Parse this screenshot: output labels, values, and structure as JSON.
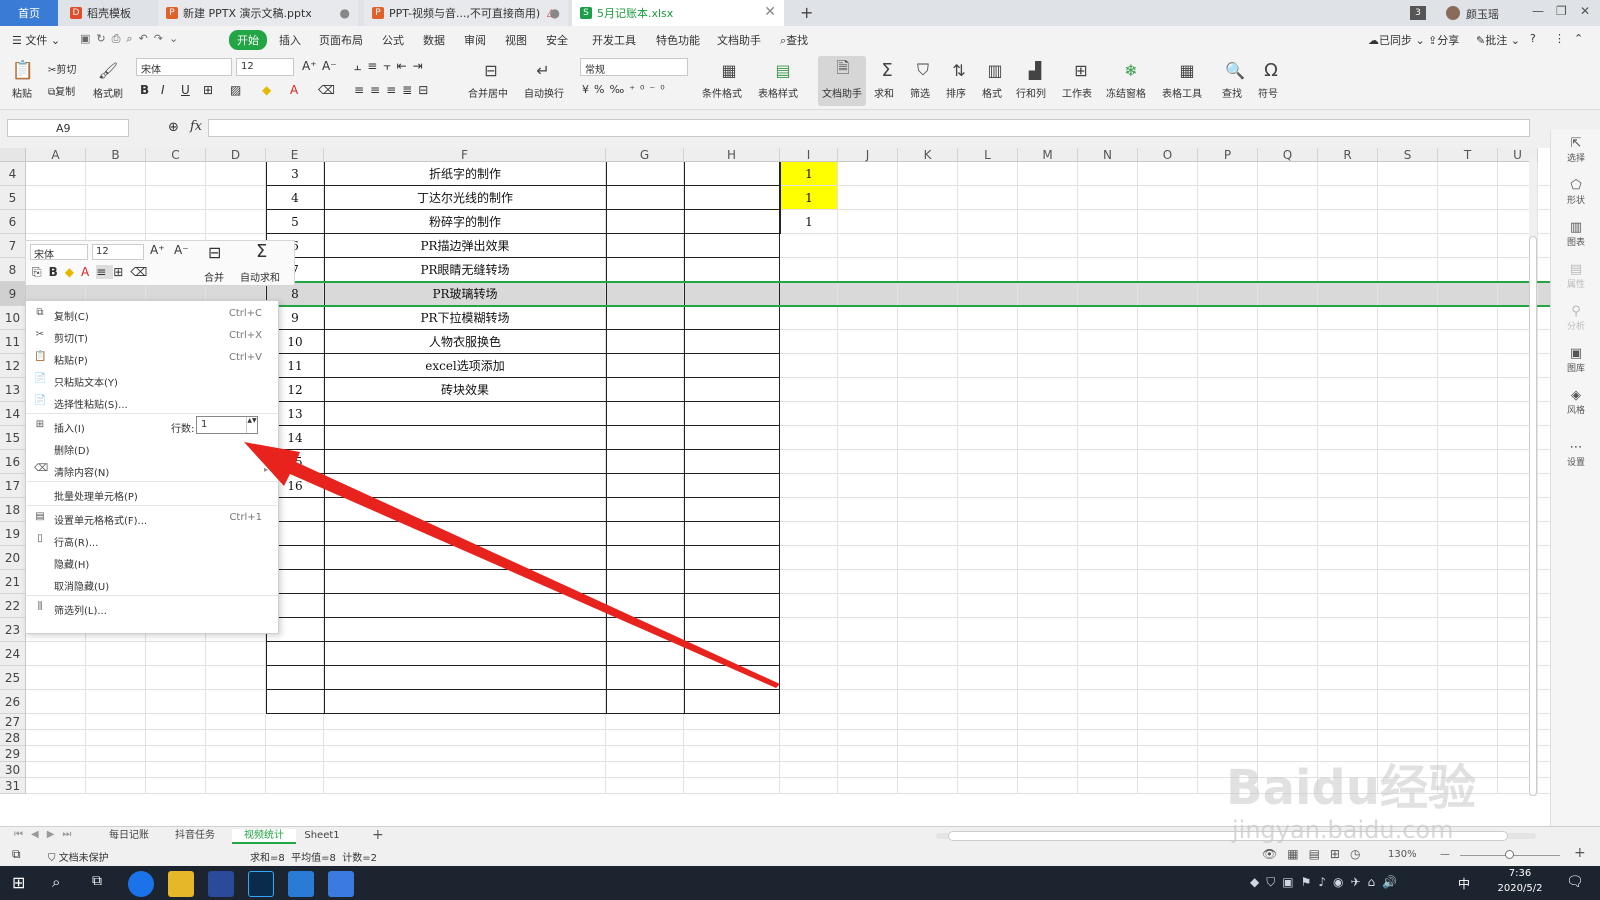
{
  "tabs": [
    {
      "label": "首页",
      "active": false
    },
    {
      "label": "稻壳模板",
      "active": false
    },
    {
      "label": "新建 PPTX 演示文稿.pptx",
      "active": false
    },
    {
      "label": "PPT-视频与音...,不可直接商用)",
      "active": false
    },
    {
      "label": "5月记账本.xlsx",
      "active": true
    }
  ],
  "titlebar": {
    "badge": "3",
    "user": "颜玉瑶"
  },
  "menu": {
    "file": "文件",
    "items": [
      "开始",
      "插入",
      "页面布局",
      "公式",
      "数据",
      "审阅",
      "视图",
      "安全",
      "开发工具",
      "特色功能",
      "文档助手"
    ],
    "search": "查找",
    "right": [
      "已同步",
      "分享",
      "批注"
    ]
  },
  "ribbon": {
    "paste": "粘贴",
    "cut": "剪切",
    "copy": "复制",
    "format_painter": "格式刷",
    "font_name": "宋体",
    "font_size": "12",
    "merge": "合并居中",
    "wrap": "自动换行",
    "number_format": "常规",
    "cond_format": "条件格式",
    "table_style": "表格样式",
    "doc_assist": "文档助手",
    "sum": "求和",
    "filter": "筛选",
    "sort": "排序",
    "format": "格式",
    "rowcol": "行和列",
    "sheet": "工作表",
    "freeze": "冻结窗格",
    "table_tools": "表格工具",
    "find": "查找",
    "symbol": "符号"
  },
  "formula_bar": {
    "name_box": "A9",
    "fx": "fx",
    "content": ""
  },
  "columns": [
    "A",
    "B",
    "C",
    "D",
    "E",
    "F",
    "G",
    "H",
    "I",
    "J",
    "K",
    "L",
    "M",
    "N",
    "O",
    "P",
    "Q",
    "R",
    "S",
    "T",
    "U"
  ],
  "rows": [
    "4",
    "5",
    "6",
    "7",
    "8",
    "9",
    "10",
    "11",
    "12",
    "13",
    "14",
    "15",
    "16",
    "17",
    "18",
    "19",
    "20",
    "21",
    "22",
    "23",
    "24",
    "25",
    "26",
    "27",
    "28",
    "29",
    "30",
    "31"
  ],
  "table": [
    {
      "num": "3",
      "name": "折纸字的制作",
      "i": "1"
    },
    {
      "num": "4",
      "name": "丁达尔光线的制作",
      "i": "1"
    },
    {
      "num": "5",
      "name": "粉碎字的制作",
      "i": "1"
    },
    {
      "num": "6",
      "name": "PR描边弹出效果",
      "i": ""
    },
    {
      "num": "7",
      "name": "PR眼睛无缝转场",
      "i": ""
    },
    {
      "num": "8",
      "name": "PR玻璃转场",
      "i": ""
    },
    {
      "num": "9",
      "name": "PR下拉模糊转场",
      "i": ""
    },
    {
      "num": "10",
      "name": "人物衣服换色",
      "i": ""
    },
    {
      "num": "11",
      "name": "excel选项添加",
      "i": ""
    },
    {
      "num": "12",
      "name": "砖块效果",
      "i": ""
    },
    {
      "num": "13",
      "name": "",
      "i": ""
    },
    {
      "num": "14",
      "name": "",
      "i": ""
    },
    {
      "num": "15",
      "name": "",
      "i": ""
    },
    {
      "num": "16",
      "name": "",
      "i": ""
    }
  ],
  "mini_toolbar": {
    "font": "宋体",
    "size": "12",
    "merge": "合并",
    "autosum": "自动求和"
  },
  "context_menu": {
    "items": [
      {
        "label": "复制(C)",
        "shortcut": "Ctrl+C",
        "icon": "copy-icon"
      },
      {
        "label": "剪切(T)",
        "shortcut": "Ctrl+X",
        "icon": "scissors-icon"
      },
      {
        "label": "粘贴(P)",
        "shortcut": "Ctrl+V",
        "icon": "paste-icon"
      },
      {
        "label": "只粘贴文本(Y)",
        "shortcut": "",
        "icon": "paste-text-icon"
      },
      {
        "label": "选择性粘贴(S)...",
        "shortcut": "",
        "icon": "paste-special-icon"
      },
      {
        "label": "插入(I)",
        "shortcut": "",
        "icon": "insert-icon"
      },
      {
        "label": "删除(D)",
        "shortcut": "",
        "icon": ""
      },
      {
        "label": "清除内容(N)",
        "shortcut": "",
        "icon": "eraser-icon"
      },
      {
        "label": "批量处理单元格(P)",
        "shortcut": "",
        "icon": ""
      },
      {
        "label": "设置单元格格式(F)...",
        "shortcut": "Ctrl+1",
        "icon": "format-cells-icon"
      },
      {
        "label": "行高(R)...",
        "shortcut": "",
        "icon": "row-height-icon"
      },
      {
        "label": "隐藏(H)",
        "shortcut": "",
        "icon": ""
      },
      {
        "label": "取消隐藏(U)",
        "shortcut": "",
        "icon": ""
      },
      {
        "label": "筛选列(L)...",
        "shortcut": "",
        "icon": "filter-columns-icon"
      }
    ],
    "rows_label": "行数:",
    "rows_value": "1"
  },
  "sheet_tabs": [
    "每日记账",
    "抖音任务",
    "视频统计",
    "Sheet1"
  ],
  "active_sheet": "视频统计",
  "status": {
    "protect": "文档未保护",
    "stats": "求和=8  平均值=8  计数=2",
    "zoom": "130%"
  },
  "right_panel": [
    "选择",
    "形状",
    "图表",
    "属性",
    "分析",
    "图库",
    "风格",
    "设置"
  ],
  "taskbar": {
    "time": "7:36",
    "date": "2020/5/2",
    "ime": "中"
  },
  "watermark": {
    "line1": "Baidu经验",
    "line2": "jingyan.baidu.com"
  },
  "colors": {
    "accent": "#22a544",
    "highlight": "#ffff00",
    "arrow": "#e8231d",
    "selected_row": "#d9d9d9"
  }
}
